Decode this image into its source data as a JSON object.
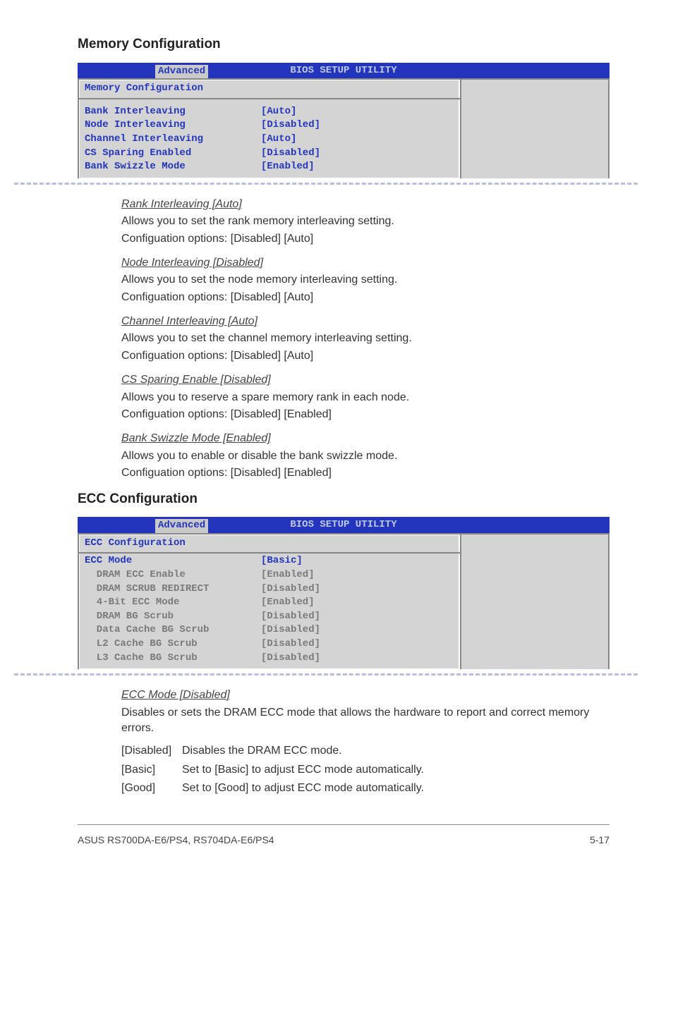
{
  "memory_section": {
    "heading": "Memory Configuration",
    "bios": {
      "utility_title": "BIOS SETUP UTILITY",
      "tab_label": "Advanced",
      "panel_title": "Memory Configuration",
      "rows": [
        {
          "label": "Bank Interleaving",
          "value": "[Auto]"
        },
        {
          "label": "Node Interleaving",
          "value": "[Disabled]"
        },
        {
          "label": "Channel Interleaving",
          "value": "[Auto]"
        },
        {
          "label": "CS Sparing Enabled",
          "value": "[Disabled]"
        },
        {
          "label": "Bank Swizzle Mode",
          "value": "[Enabled]"
        }
      ]
    },
    "items": [
      {
        "title": "Rank Interleaving [Auto]",
        "line1": "Allows you to set the rank memory interleaving setting.",
        "line2": "Configuation options: [Disabled] [Auto]"
      },
      {
        "title": "Node Interleaving [Disabled]",
        "line1": "Allows you to set the node memory interleaving setting.",
        "line2": "Configuation options: [Disabled] [Auto]"
      },
      {
        "title": "Channel Interleaving [Auto]",
        "line1": "Allows you to set the channel memory interleaving setting.",
        "line2": "Configuation options: [Disabled] [Auto]"
      },
      {
        "title": "CS Sparing Enable [Disabled]",
        "line1": "Allows you to reserve a spare memory rank in each node.",
        "line2": "Configuation options: [Disabled] [Enabled]"
      },
      {
        "title": "Bank Swizzle Mode [Enabled]",
        "line1": "Allows you to enable or disable the bank swizzle mode.",
        "line2": "Configuation options: [Disabled] [Enabled]"
      }
    ]
  },
  "ecc_section": {
    "heading": "ECC Configuration",
    "bios": {
      "utility_title": "BIOS SETUP UTILITY",
      "tab_label": "Advanced",
      "panel_title": "ECC Configuration",
      "rows": [
        {
          "label": "ECC Mode",
          "value": "[Basic]",
          "sub": false
        },
        {
          "label": "  DRAM ECC Enable",
          "value": "[Enabled]",
          "sub": true
        },
        {
          "label": "  DRAM SCRUB REDIRECT",
          "value": "[Disabled]",
          "sub": true
        },
        {
          "label": "  4-Bit ECC Mode",
          "value": "[Enabled]",
          "sub": true
        },
        {
          "label": "  DRAM BG Scrub",
          "value": "[Disabled]",
          "sub": true
        },
        {
          "label": "  Data Cache BG Scrub",
          "value": "[Disabled]",
          "sub": true
        },
        {
          "label": "  L2 Cache BG Scrub",
          "value": "[Disabled]",
          "sub": true
        },
        {
          "label": "  L3 Cache BG Scrub",
          "value": "[Disabled]",
          "sub": true
        }
      ]
    },
    "desc": {
      "title": "ECC Mode [Disabled]",
      "text": "Disables or sets the DRAM ECC mode that allows the hardware to report and correct memory errors."
    },
    "options": [
      {
        "key": "[Disabled]",
        "desc": "Disables the DRAM ECC mode."
      },
      {
        "key": "[Basic]",
        "desc": "Set to [Basic] to adjust ECC mode automatically."
      },
      {
        "key": "[Good]",
        "desc": "Set to [Good] to adjust ECC mode automatically."
      }
    ]
  },
  "footer": {
    "left": "ASUS RS700DA-E6/PS4, RS704DA-E6/PS4",
    "right": "5-17"
  }
}
